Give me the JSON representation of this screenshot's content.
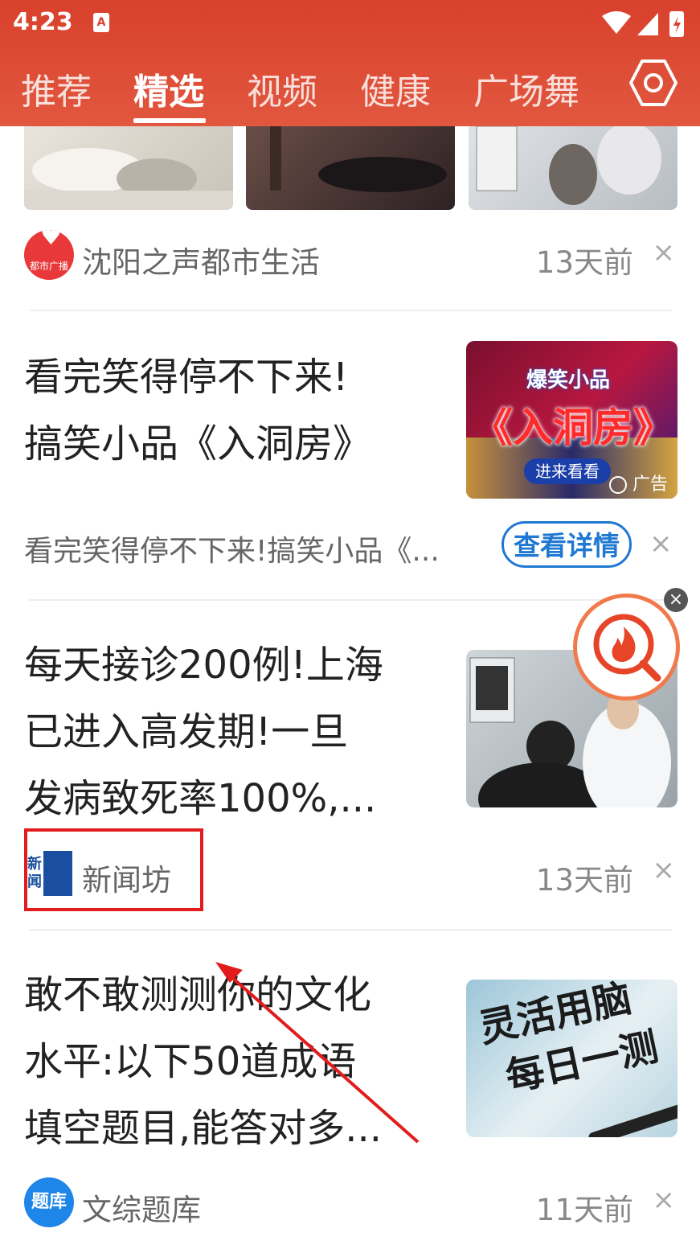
{
  "status": {
    "time": "4:23",
    "notif_badge": "A"
  },
  "tabs": [
    {
      "label": "推荐",
      "active": false
    },
    {
      "label": "精选",
      "active": true
    },
    {
      "label": "视频",
      "active": false
    },
    {
      "label": "健康",
      "active": false
    },
    {
      "label": "广场舞",
      "active": false
    }
  ],
  "colors": {
    "header": "#d8412c",
    "accent_blue": "#1f78d1",
    "highlight_red": "#e21c1c"
  },
  "feed": {
    "item1": {
      "source": "沈阳之声都市生活",
      "time": "13天前",
      "logo_text": "都市广播"
    },
    "ad": {
      "title_line1": "看完笑得停不下来!",
      "title_line2": "搞笑小品《入洞房》",
      "desc": "看完笑得停不下来!搞笑小品《...",
      "button": "查看详情",
      "thumb_top": "爆笑小品",
      "thumb_main": "《入洞房》",
      "thumb_cta": "进来看看",
      "ad_label": "广告"
    },
    "item2": {
      "title_line1": "每天接诊200例!上海",
      "title_line2": "已进入高发期!一旦",
      "title_line3": "发病致死率100%,...",
      "source": "新闻坊",
      "time": "13天前",
      "logo_text": "新闻"
    },
    "item3": {
      "title_line1": "敢不敢测测你的文化",
      "title_line2": "水平:以下50道成语",
      "title_line3": "填空题目,能答对多...",
      "source": "文综题库",
      "time": "11天前",
      "logo_text": "题库",
      "thumb_line1": "灵活用脑",
      "thumb_line2": "每日一测"
    },
    "close_glyph": "×"
  }
}
